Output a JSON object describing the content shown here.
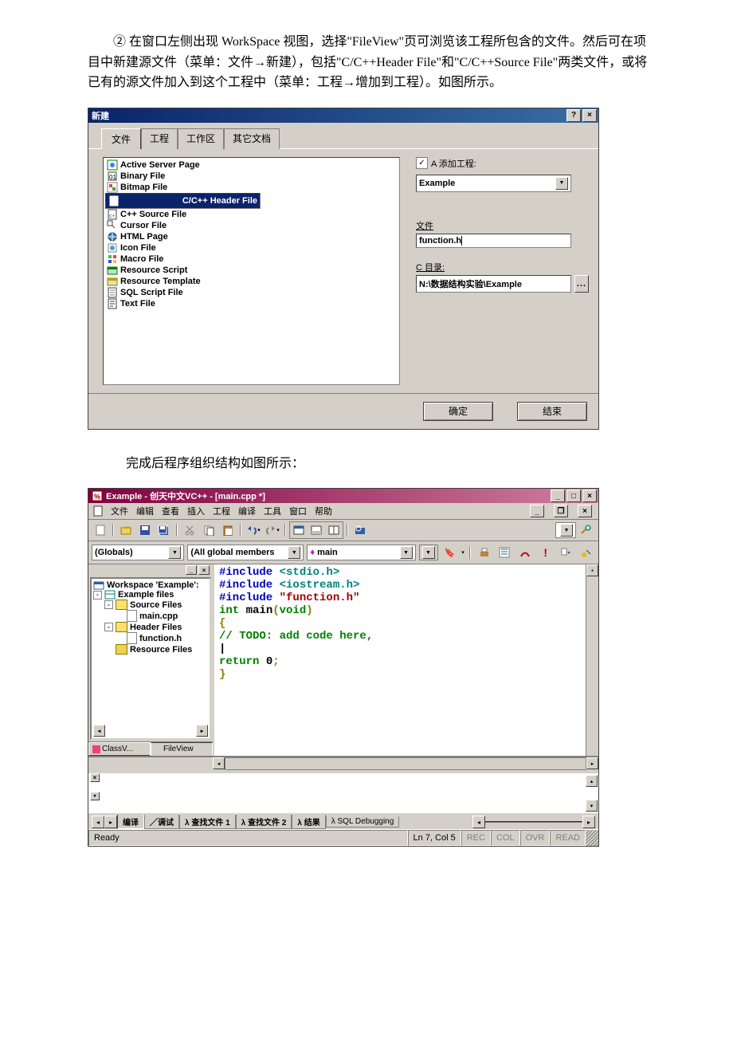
{
  "para": {
    "p1a": "② 在窗口左侧出现 WorkSpace 视图，选择\"FileView\"页可浏览该工程所包含的文件。然后可在项目中新建源文件（菜单：文件",
    "p1b": "新建），包括\"C/C++Header File\"和\"C/C++Source File\"两类文件，或将已有的源文件加入到这个工程中（菜单：工程",
    "p1c": "增加到工程）。如图所示。",
    "p2": "完成后程序组织结构如图所示："
  },
  "dlg": {
    "title": "新建",
    "tabs": [
      "文件",
      "工程",
      "工作区",
      "其它文档"
    ],
    "file_types": [
      "Active Server Page",
      "Binary File",
      "Bitmap File",
      "C/C++ Header File",
      "C++ Source File",
      "Cursor File",
      "HTML Page",
      "Icon File",
      "Macro File",
      "Resource Script",
      "Resource Template",
      "SQL Script File",
      "Text File"
    ],
    "selected_type_index": 3,
    "add_to_project_label": "A 添加工程:",
    "add_to_project_checked": true,
    "project_value": "Example",
    "file_label": "文件",
    "file_value": "function.h",
    "dir_label": "C 目录:",
    "dir_value": "N:\\数据结构实验\\Example",
    "ok": "确定",
    "close": "结束"
  },
  "ide": {
    "title": "Example - 创天中文VC++ - [main.cpp *]",
    "menu": [
      "文件",
      "编辑",
      "查看",
      "插入",
      "工程",
      "编译",
      "工具",
      "窗口",
      "帮助"
    ],
    "combo1": "(Globals)",
    "combo2": "(All global members",
    "combo3": "main",
    "tree": {
      "workspace": "Workspace 'Example':",
      "project": "Example files",
      "source_group": "Source Files",
      "source_file": "main.cpp",
      "header_group": "Header Files",
      "header_file": "function.h",
      "resource_group": "Resource Files"
    },
    "panel_tabs": [
      "ClassV...",
      "FileView"
    ],
    "code_lines": [
      {
        "segments": [
          {
            "t": "#include ",
            "c": "kw-blue"
          },
          {
            "t": "<stdio.h>",
            "c": "kw-teal"
          }
        ]
      },
      {
        "segments": [
          {
            "t": "#include ",
            "c": "kw-blue"
          },
          {
            "t": "<iostream.h>",
            "c": "kw-teal"
          }
        ]
      },
      {
        "segments": [
          {
            "t": "#include ",
            "c": "kw-blue"
          },
          {
            "t": "\"function.h\"",
            "c": "kw-red"
          }
        ]
      },
      {
        "segments": [
          {
            "t": "int ",
            "c": "kw-green"
          },
          {
            "t": "main",
            "c": ""
          },
          {
            "t": "(",
            "c": "kw-brown"
          },
          {
            "t": "void",
            "c": "kw-green"
          },
          {
            "t": ")",
            "c": "kw-brown"
          }
        ]
      },
      {
        "segments": [
          {
            "t": "{",
            "c": "kw-brown"
          }
        ]
      },
      {
        "segments": [
          {
            "t": "    ",
            "c": ""
          },
          {
            "t": "// TODO: add  code here,",
            "c": "kw-green"
          }
        ]
      },
      {
        "segments": [
          {
            "t": "    |",
            "c": ""
          }
        ]
      },
      {
        "segments": [
          {
            "t": "",
            "c": ""
          }
        ]
      },
      {
        "segments": [
          {
            "t": "    ",
            "c": ""
          },
          {
            "t": "return",
            "c": "kw-green"
          },
          {
            "t": " 0",
            "c": ""
          },
          {
            "t": ";",
            "c": "kw-brown"
          }
        ]
      },
      {
        "segments": [
          {
            "t": "}",
            "c": "kw-brown"
          }
        ]
      }
    ],
    "output_tabs": [
      "编译",
      "调试",
      "查找文件 1",
      "查找文件 2",
      "结果",
      "SQL Debugging"
    ],
    "status_ready": "Ready",
    "status_pos": "Ln 7, Col 5",
    "status_ind": [
      "REC",
      "COL",
      "OVR",
      "READ"
    ]
  }
}
